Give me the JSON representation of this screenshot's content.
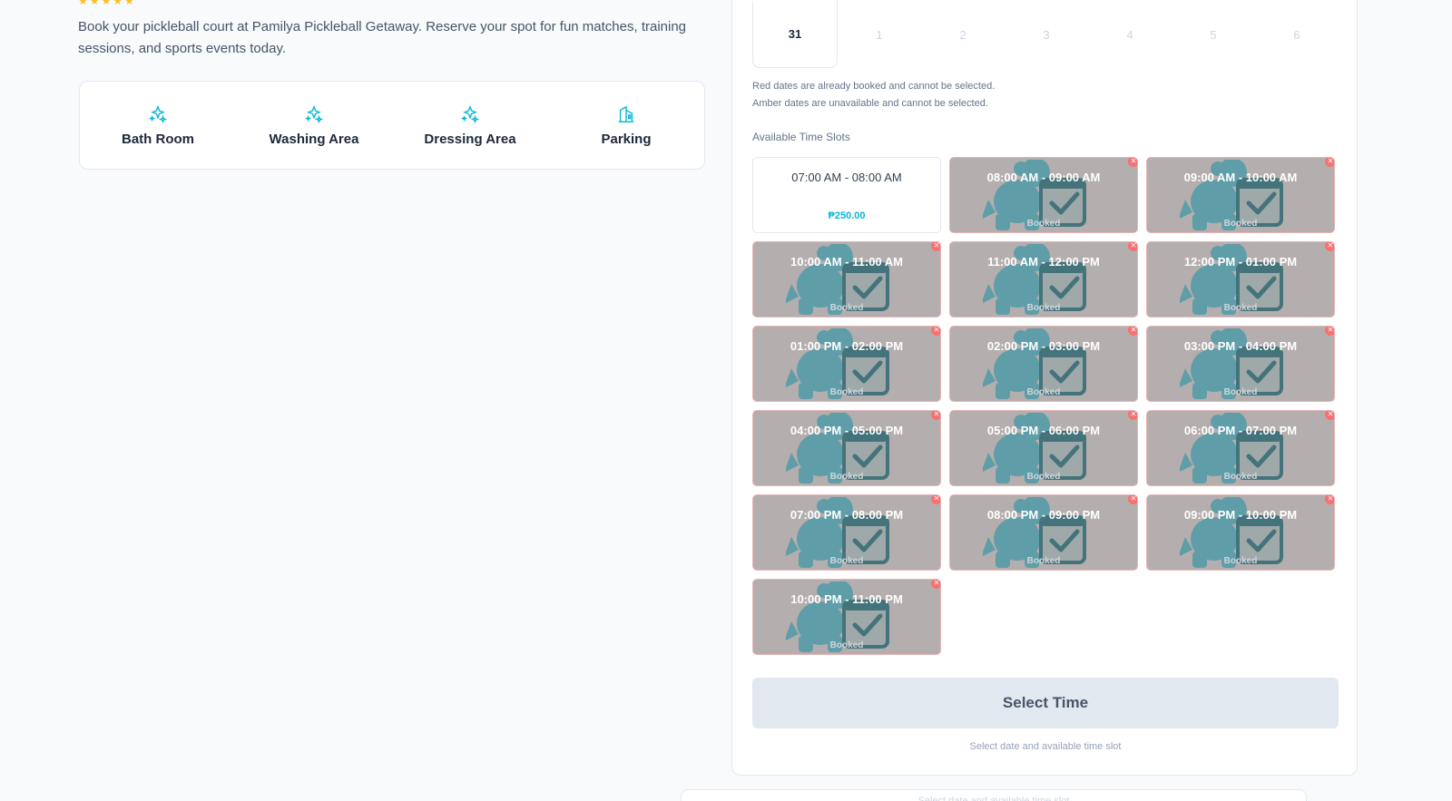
{
  "venue": {
    "rating_stars": "★★★★★",
    "description": "Book your pickleball court at Pamilya Pickleball Getaway. Reserve your spot for fun matches, training sessions, and sports events today."
  },
  "amenities": [
    {
      "label": "Bath Room",
      "icon": "sparkles-icon"
    },
    {
      "label": "Washing Area",
      "icon": "sparkles-icon"
    },
    {
      "label": "Dressing Area",
      "icon": "sparkles-icon"
    },
    {
      "label": "Parking",
      "icon": "parking-building-icon"
    }
  ],
  "calendar": {
    "dates": [
      "31",
      "1",
      "2",
      "3",
      "4",
      "5",
      "6"
    ],
    "selected_date": "31",
    "legend_red": "Red dates are already booked and cannot be selected.",
    "legend_amber": "Amber dates are unavailable and cannot be selected."
  },
  "time_slots": {
    "title": "Available Time Slots",
    "slots": [
      {
        "time": "07:00 AM - 08:00 AM",
        "price": "₱250.00",
        "status": ""
      },
      {
        "time": "08:00 AM - 09:00 AM",
        "price": "",
        "status": "Booked"
      },
      {
        "time": "09:00 AM - 10:00 AM",
        "price": "",
        "status": "Booked"
      },
      {
        "time": "10:00 AM - 11:00 AM",
        "price": "",
        "status": "Booked"
      },
      {
        "time": "11:00 AM - 12:00 PM",
        "price": "",
        "status": "Booked"
      },
      {
        "time": "12:00 PM - 01:00 PM",
        "price": "",
        "status": "Booked"
      },
      {
        "time": "01:00 PM - 02:00 PM",
        "price": "",
        "status": "Booked"
      },
      {
        "time": "02:00 PM - 03:00 PM",
        "price": "",
        "status": "Booked"
      },
      {
        "time": "03:00 PM - 04:00 PM",
        "price": "",
        "status": "Booked"
      },
      {
        "time": "04:00 PM - 05:00 PM",
        "price": "",
        "status": "Booked"
      },
      {
        "time": "05:00 PM - 06:00 PM",
        "price": "",
        "status": "Booked"
      },
      {
        "time": "06:00 PM - 07:00 PM",
        "price": "",
        "status": "Booked"
      },
      {
        "time": "07:00 PM - 08:00 PM",
        "price": "",
        "status": "Booked"
      },
      {
        "time": "08:00 PM - 09:00 PM",
        "price": "",
        "status": "Booked"
      },
      {
        "time": "09:00 PM - 10:00 PM",
        "price": "",
        "status": "Booked"
      },
      {
        "time": "10:00 PM - 11:00 PM",
        "price": "",
        "status": "Booked"
      }
    ]
  },
  "actions": {
    "select_button": "Select Time",
    "hint": "Select date and available time slot"
  },
  "colors": {
    "accent": "#06b6d4",
    "booked_bg": "#b5aeae",
    "booked_badge": "#f87171",
    "art": "#5f9ea8"
  }
}
